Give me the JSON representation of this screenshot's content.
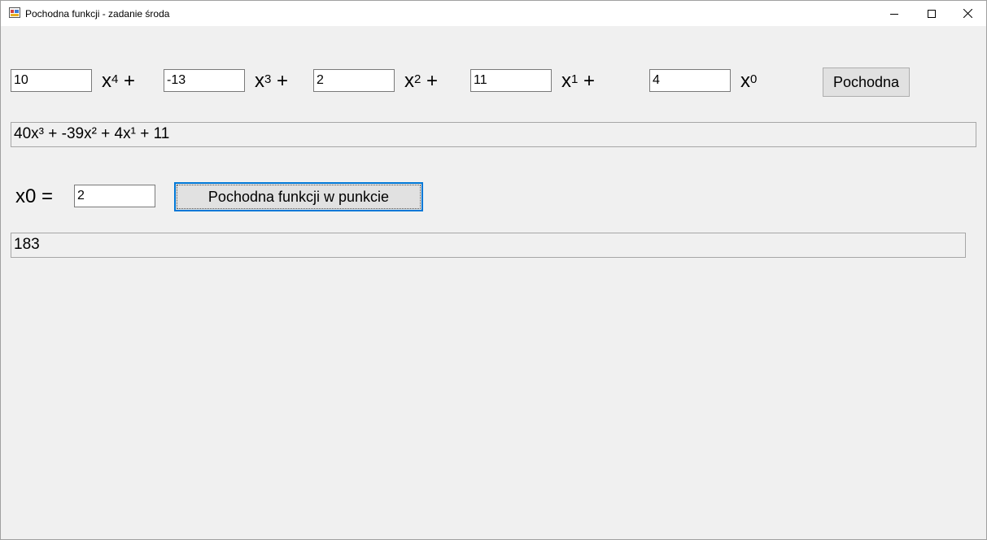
{
  "window": {
    "title": "Pochodna funkcji - zadanie środa"
  },
  "coefficients": [
    {
      "value": "10",
      "term": "x",
      "power": "4",
      "sign": "+"
    },
    {
      "value": "-13",
      "term": "x",
      "power": "3",
      "sign": "+"
    },
    {
      "value": "2",
      "term": "x",
      "power": "2",
      "sign": "+"
    },
    {
      "value": "11",
      "term": "x",
      "power": "1",
      "sign": "+"
    },
    {
      "value": "4",
      "term": "x",
      "power": "0",
      "sign": ""
    }
  ],
  "derivative_button_label": "Pochodna",
  "derivative_result": "40x³ + -39x² + 4x¹ + 11",
  "x0": {
    "label": "x0 =",
    "value": "2"
  },
  "point_button_label": "Pochodna funkcji w punkcie",
  "point_result": "183",
  "icons": {
    "app": "app-icon",
    "minimize": "minimize-icon",
    "maximize": "maximize-icon",
    "close": "close-icon"
  }
}
